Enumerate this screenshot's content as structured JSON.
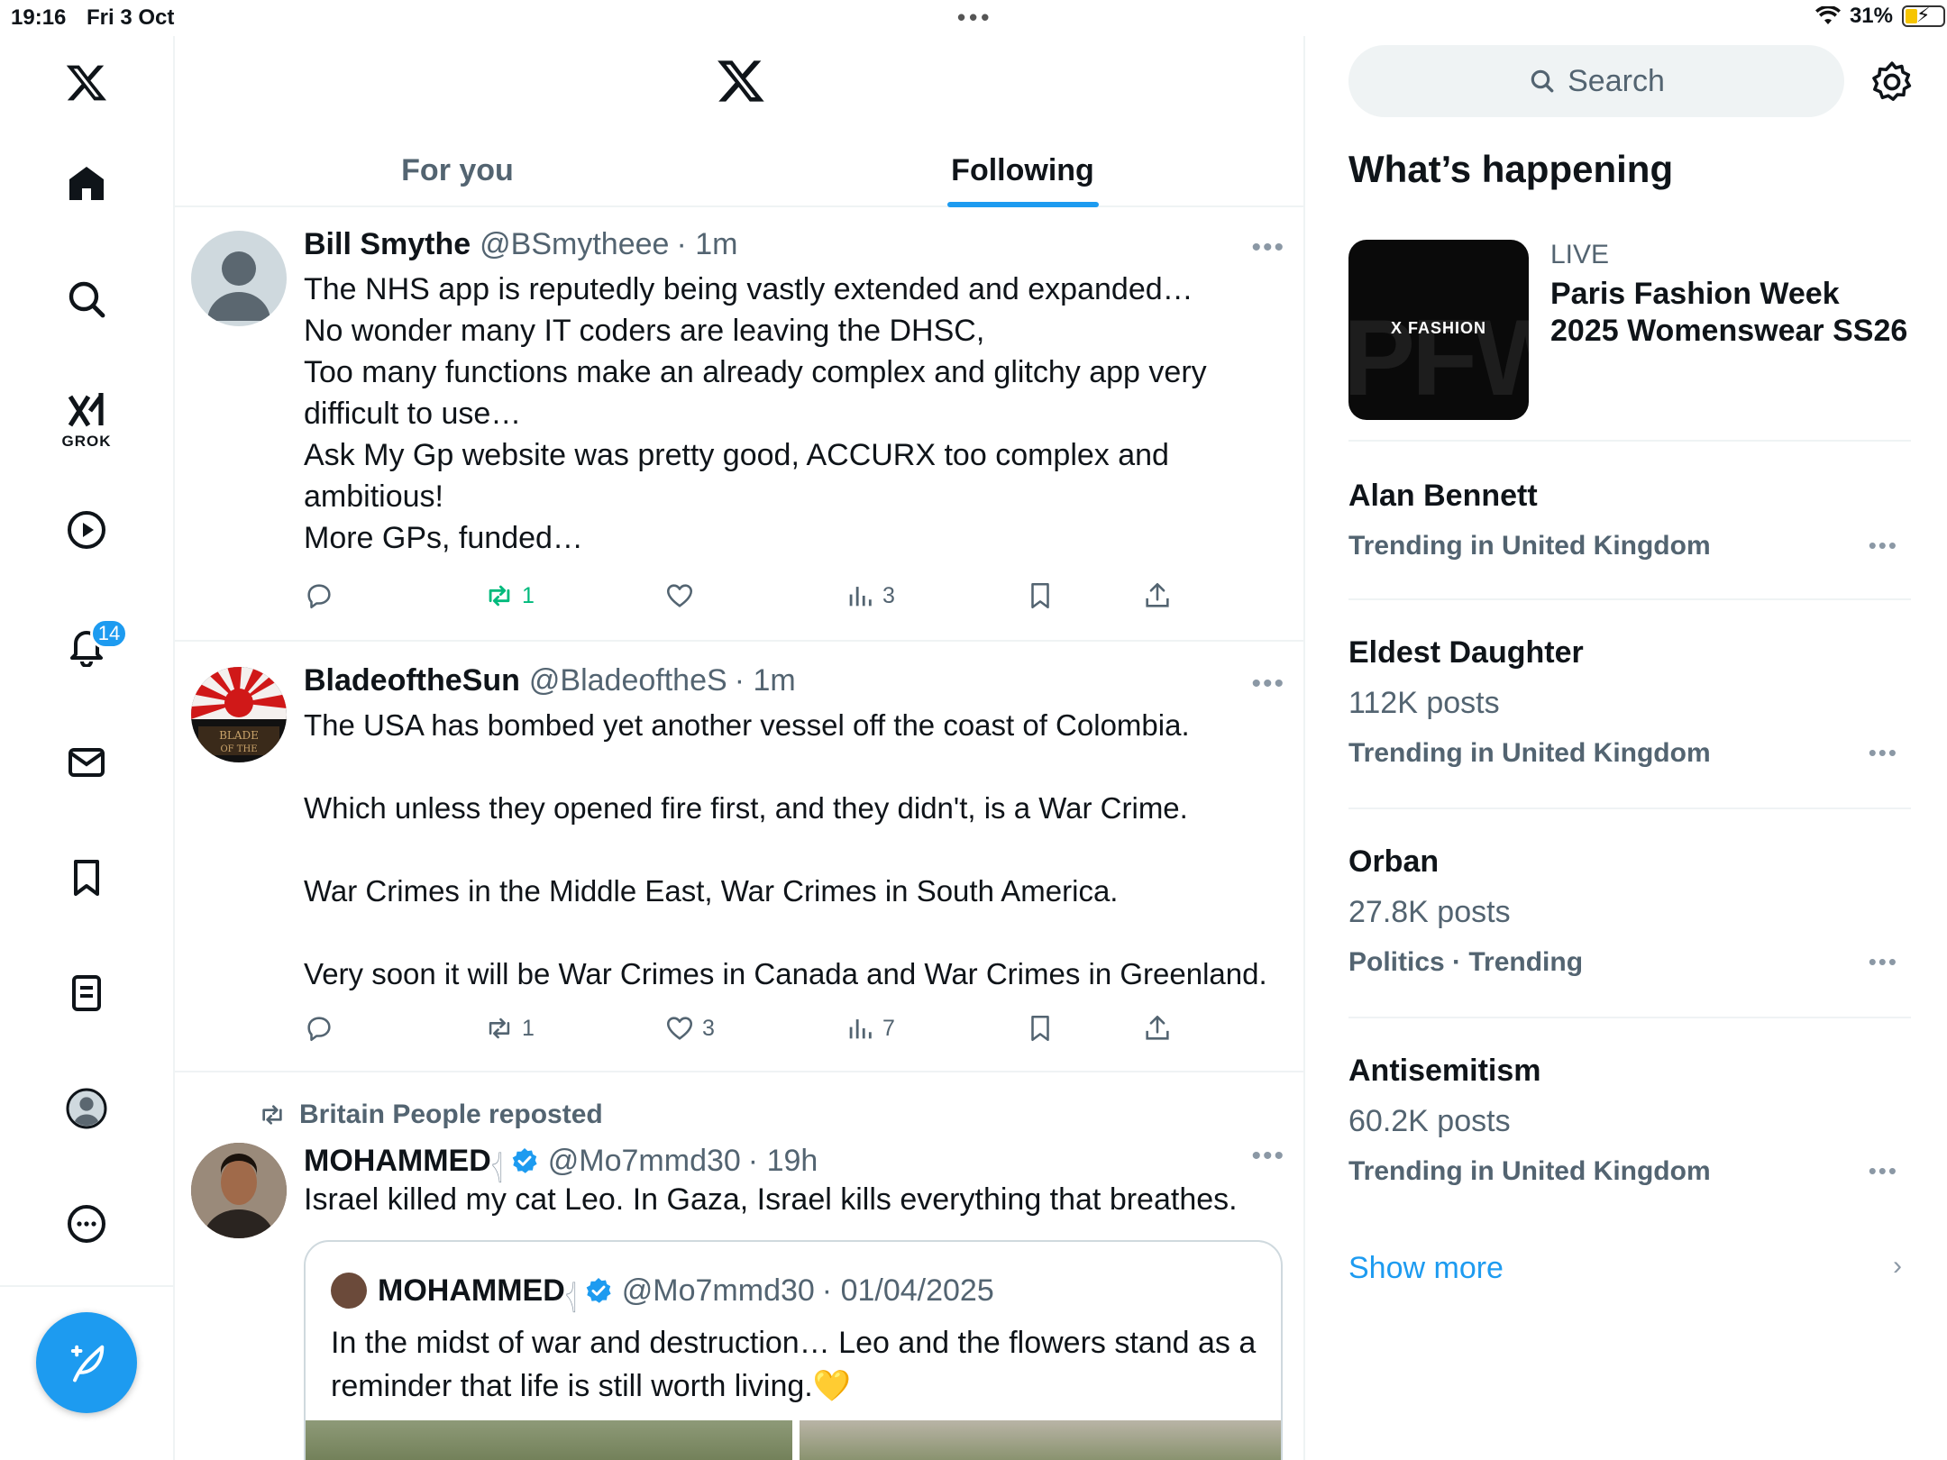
{
  "status_bar": {
    "time": "19:16",
    "date": "Fri 3 Oct",
    "battery": "31%"
  },
  "sidebar": {
    "grok_label": "GROK",
    "notifications_badge": "14"
  },
  "tabs": [
    {
      "label": "For you",
      "active": false
    },
    {
      "label": "Following",
      "active": true
    }
  ],
  "tweets": [
    {
      "name": "Bill Smythe",
      "handle": "@BSmytheee",
      "time": "· 1m",
      "lines": [
        "The NHS app is reputedly being vastly extended and expanded…",
        "No wonder many IT coders are leaving the DHSC,",
        "Too many functions make an already complex and glitchy app very",
        "difficult to use…",
        "Ask My Gp website was pretty good, ACCURX too complex and",
        "ambitious!",
        "More GPs, funded…"
      ],
      "reposts": "1",
      "likes": "",
      "views": "3"
    },
    {
      "name": "BladeoftheSun",
      "handle": "@BladeoftheS",
      "time": "· 1m",
      "lines": [
        "The USA has bombed yet another vessel off the coast of Colombia.",
        "",
        "Which unless they opened fire first, and they didn't, is a War Crime.",
        "",
        "War Crimes in the Middle East, War Crimes in South America.",
        "",
        "Very soon it will be War Crimes in Canada and War Crimes in Greenland."
      ],
      "reposts": "1",
      "likes": "3",
      "views": "7"
    },
    {
      "repost_label": "Britain People reposted",
      "name": "MOHAMMED",
      "name_suffix": "𓂆",
      "handle": "@Mo7mmd30",
      "time": "· 19h",
      "text": "Israel killed my cat Leo. In Gaza, Israel kills everything that breathes.",
      "quote": {
        "name": "MOHAMMED",
        "name_suffix": "𓂆",
        "handle": "@Mo7mmd30",
        "date": "· 01/04/2025",
        "text": "In the midst of war and destruction… Leo and the flowers stand as a reminder that life is still worth living.💛"
      }
    }
  ],
  "right_column": {
    "search_placeholder": "Search",
    "section_title": "What’s happening",
    "live": {
      "label": "LIVE",
      "title": "Paris Fashion Week 2025 Womenswear SS26",
      "image_brand": "X FASHION",
      "image_ghost_text": "PFW"
    },
    "trends": [
      {
        "name": "Alan Bennett",
        "posts": "",
        "context": "Trending in United Kingdom"
      },
      {
        "name": "Eldest Daughter",
        "posts": "112K posts",
        "context": "Trending in United Kingdom"
      },
      {
        "name": "Orban",
        "posts": "27.8K posts",
        "context": "Politics · Trending"
      },
      {
        "name": "Antisemitism",
        "posts": "60.2K posts",
        "context": "Trending in United Kingdom"
      }
    ],
    "show_more": "Show more"
  },
  "colors": {
    "accent": "#1d9bf0",
    "repost_green": "#00ba7c",
    "secondary_text": "#536471",
    "divider": "#eff3f4"
  }
}
